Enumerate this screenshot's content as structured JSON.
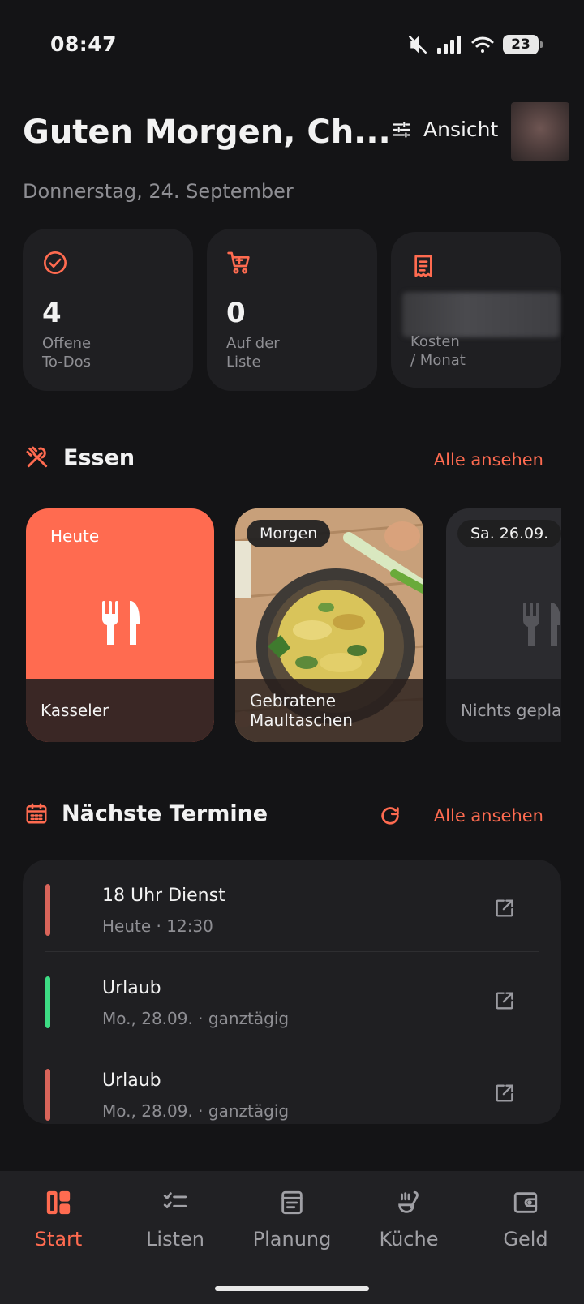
{
  "status_bar": {
    "time": "08:47",
    "battery": "23"
  },
  "header": {
    "greeting": "Guten Morgen, Ch...",
    "view_label": "Ansicht",
    "date": "Donnerstag, 24. September"
  },
  "stats": [
    {
      "icon": "check-circle-icon",
      "value": "4",
      "label_line1": "Offene",
      "label_line2": "To-Dos"
    },
    {
      "icon": "cart-icon",
      "value": "0",
      "label_line1": "Auf der",
      "label_line2": "Liste"
    },
    {
      "icon": "receipt-icon",
      "value": "",
      "label_line1": "Kosten",
      "label_line2": "/ Monat"
    }
  ],
  "meals": {
    "title": "Essen",
    "see_all": "Alle ansehen",
    "items": [
      {
        "day": "Heute",
        "name": "Kasseler"
      },
      {
        "day": "Morgen",
        "name_line1": "Gebratene",
        "name_line2": "Maultaschen"
      },
      {
        "day": "Sa. 26.09.",
        "name": "Nichts geplant"
      }
    ]
  },
  "appointments": {
    "title": "Nächste Termine",
    "see_all": "Alle ansehen",
    "items": [
      {
        "title": "18 Uhr Dienst",
        "sub": "Heute · 12:30",
        "color": "#d9645a"
      },
      {
        "title": "Urlaub",
        "sub": "Mo., 28.09. · ganztägig",
        "color": "#3ddc84"
      },
      {
        "title": "Urlaub",
        "sub": "Mo., 28.09. · ganztägig",
        "color": "#d9645a"
      }
    ]
  },
  "nav": [
    {
      "label": "Start",
      "active": true
    },
    {
      "label": "Listen"
    },
    {
      "label": "Planung"
    },
    {
      "label": "Küche"
    },
    {
      "label": "Geld"
    }
  ],
  "colors": {
    "accent": "#ff6b50",
    "background": "#141416",
    "card": "#1f1f22"
  }
}
